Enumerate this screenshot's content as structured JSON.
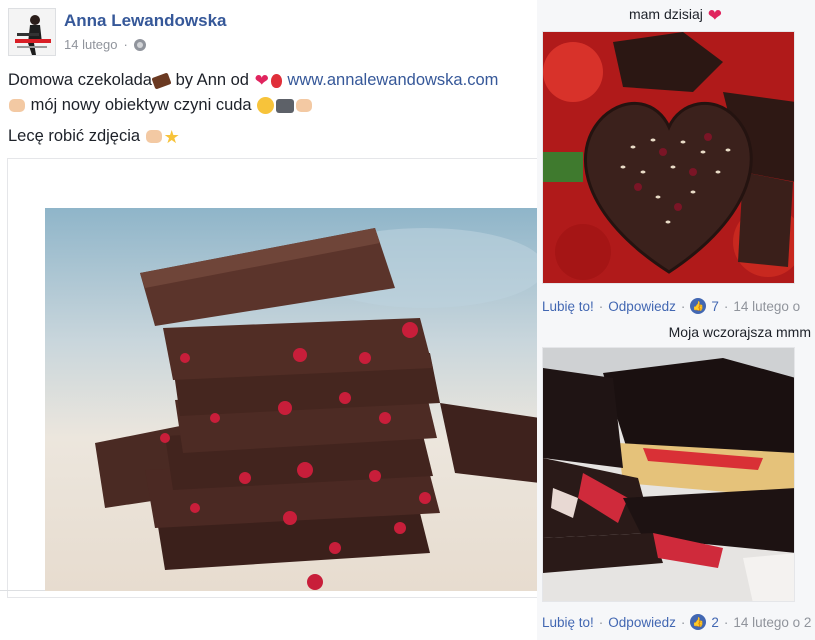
{
  "post": {
    "author": "Anna Lewandowska",
    "date": "14 lutego",
    "line1_text": "Domowa czekolada",
    "line1_by": " by Ann od ",
    "line1_link": "www.annalewandowska.com",
    "line2_text": " mój nowy obiektyw czyni cuda ",
    "line3_text": "Lecę robić zdjęcia "
  },
  "comments": [
    {
      "text": "mam dzisiaj",
      "like_label": "Lubię to!",
      "reply_label": "Odpowiedz",
      "likes": "7",
      "time": "14 lutego o"
    },
    {
      "text": "Moja wczorajsza mmm",
      "like_label": "Lubię to!",
      "reply_label": "Odpowiedz",
      "likes": "2",
      "time": "14 lutego o 2"
    }
  ],
  "colors": {
    "link": "#365899",
    "action": "#4267b2",
    "meta": "#90949c"
  },
  "icons": [
    "globe-icon",
    "chocolate-emoji-icon",
    "heart-emoji-icon",
    "balloon-emoji-icon",
    "pointing-hand-emoji-icon",
    "smile-emoji-icon",
    "camera-emoji-icon",
    "flexed-arm-emoji-icon",
    "ok-hand-emoji-icon",
    "star-emoji-icon",
    "like-thumb-icon"
  ]
}
